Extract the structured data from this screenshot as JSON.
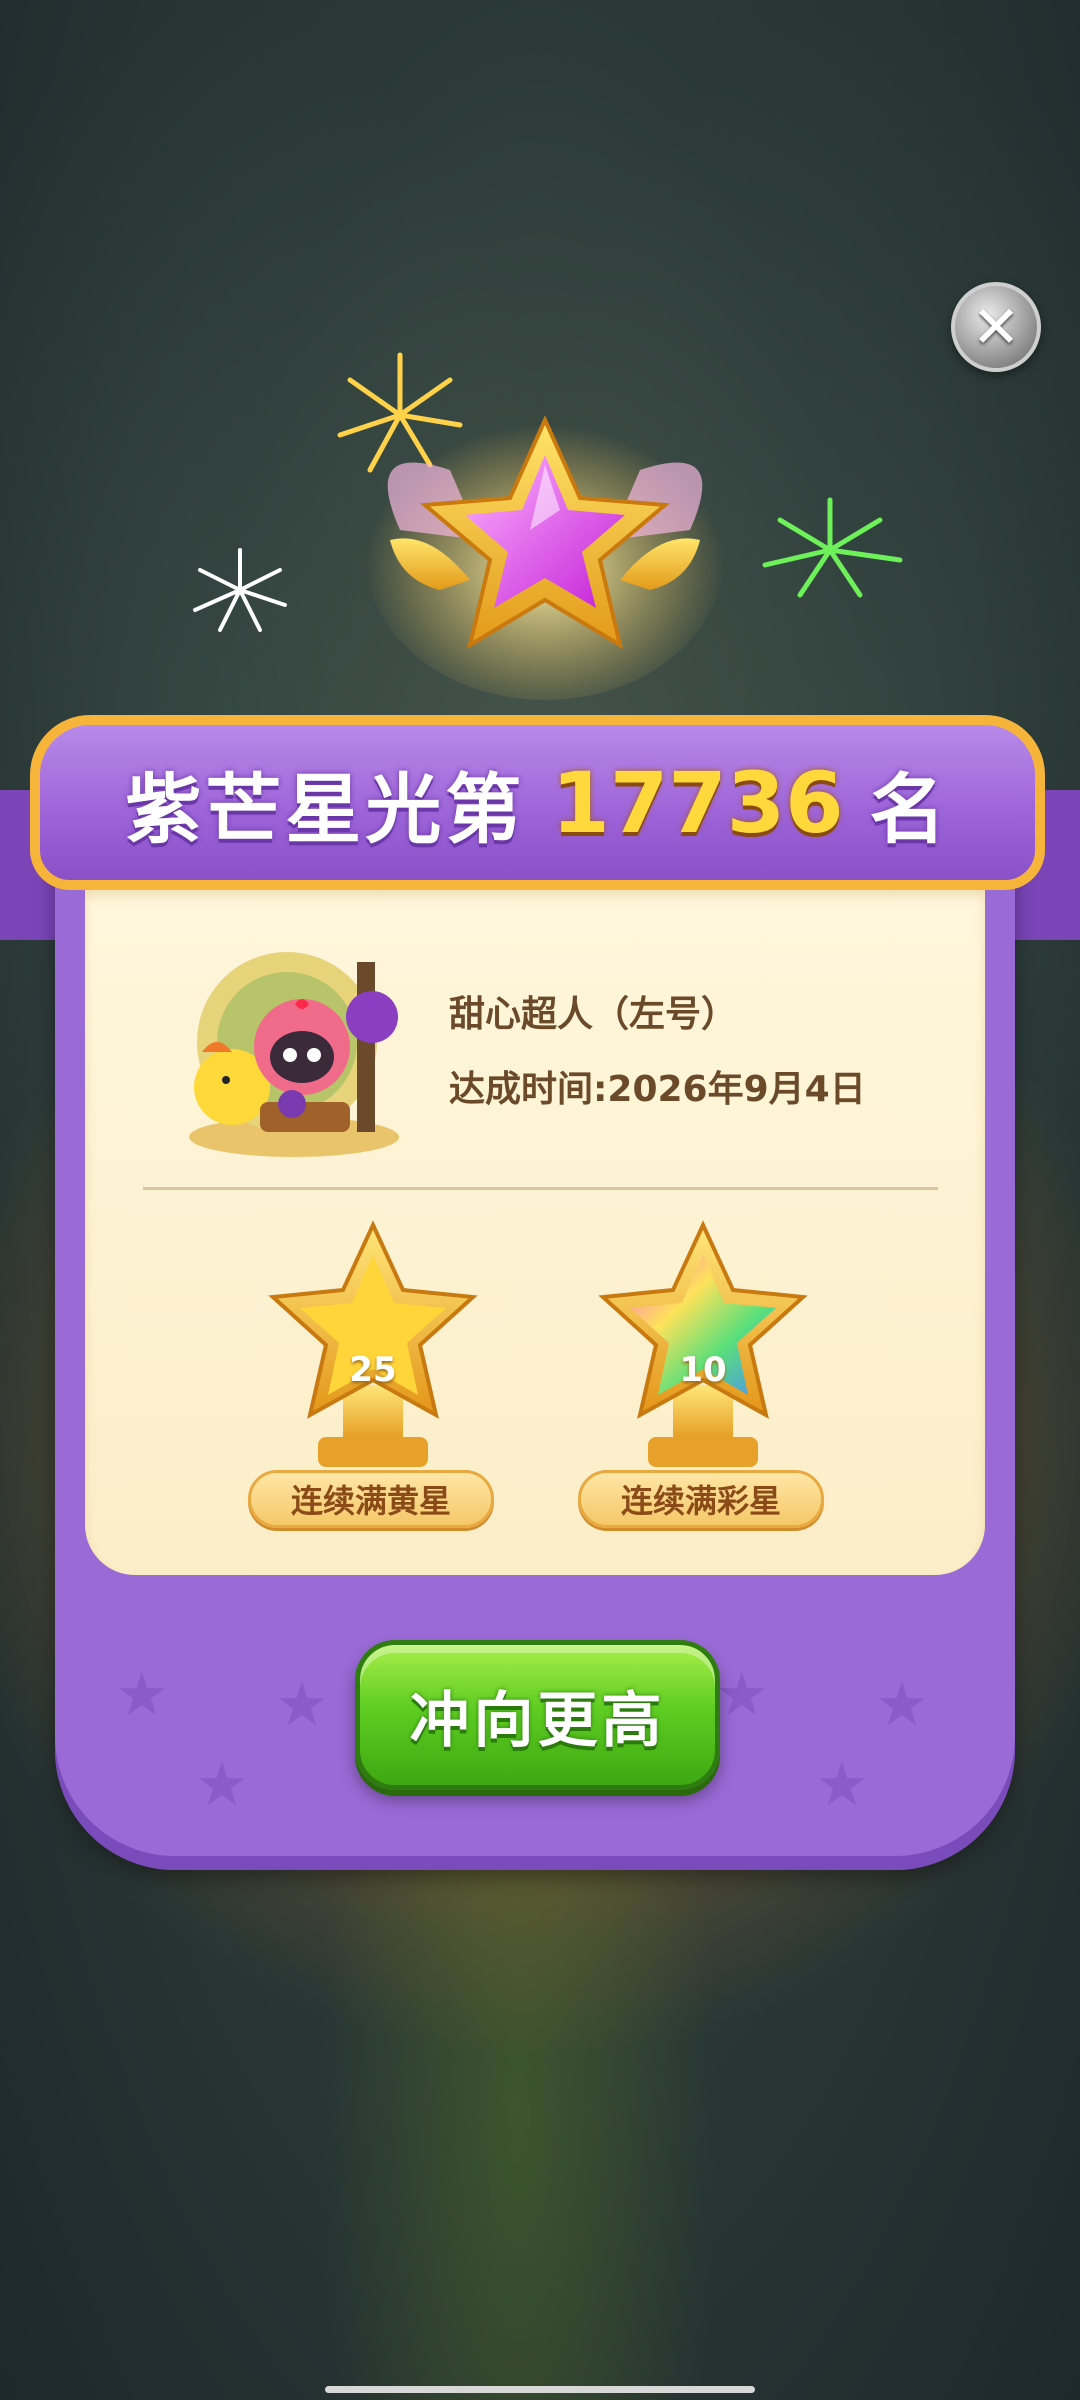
{
  "header": {
    "title_prefix": "紫芒星光第",
    "rank": "17736",
    "title_suffix": "名"
  },
  "player": {
    "name": "甜心超人（左号）",
    "achieved": "达成时间:2026年9月4日"
  },
  "trophies": [
    {
      "value": "25",
      "label": "连续满黄星",
      "kind": "gold-star-trophy-icon"
    },
    {
      "value": "10",
      "label": "连续满彩星",
      "kind": "rainbow-star-trophy-icon"
    }
  ],
  "cta": {
    "label": "冲向更高"
  },
  "close": {
    "glyph": "✕"
  },
  "colors": {
    "panel": "#9a6ad6",
    "ribbon_border": "#f6b53a",
    "rank": "#ffd83b",
    "cta": "#5fcd22"
  }
}
